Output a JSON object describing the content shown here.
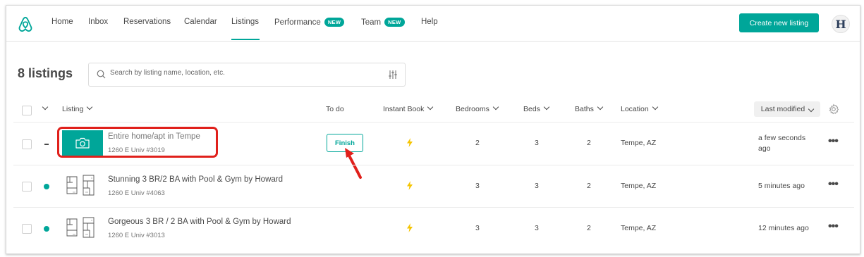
{
  "nav": {
    "items": [
      {
        "label": "Home"
      },
      {
        "label": "Inbox"
      },
      {
        "label": "Reservations"
      },
      {
        "label": "Calendar"
      },
      {
        "label": "Listings"
      },
      {
        "label": "Performance",
        "badge": "NEW"
      },
      {
        "label": "Team",
        "badge": "NEW"
      },
      {
        "label": "Help"
      }
    ],
    "active": "Listings",
    "create_button": "Create new listing",
    "avatar_letter": "H"
  },
  "toolbar": {
    "count": "8 listings",
    "search_placeholder": "Search by listing name, location, etc."
  },
  "table": {
    "headers": {
      "listing": "Listing",
      "todo": "To do",
      "instant_book": "Instant Book",
      "bedrooms": "Bedrooms",
      "beds": "Beds",
      "baths": "Baths",
      "location": "Location",
      "last_modified": "Last modified"
    },
    "rows": [
      {
        "title": "Entire home/apt in Tempe",
        "address": "1260 E Univ #3019",
        "todo": "Finish",
        "bedrooms": "2",
        "beds": "3",
        "baths": "2",
        "location": "Tempe, AZ",
        "modified_line1": "a few seconds",
        "modified_line2": "ago",
        "status": "incomplete"
      },
      {
        "title": "Stunning 3 BR/2 BA with Pool & Gym by Howard",
        "address": "1260 E Univ #4063",
        "todo": "",
        "bedrooms": "3",
        "beds": "3",
        "baths": "2",
        "location": "Tempe, AZ",
        "modified_line1": "5 minutes ago",
        "modified_line2": "",
        "status": "listed"
      },
      {
        "title": "Gorgeous 3 BR / 2 BA with Pool & Gym by Howard",
        "address": "1260 E Univ #3013",
        "todo": "",
        "bedrooms": "3",
        "beds": "3",
        "baths": "2",
        "location": "Tempe, AZ",
        "modified_line1": "12 minutes ago",
        "modified_line2": "",
        "status": "listed"
      }
    ]
  },
  "colors": {
    "accent": "#00a699",
    "annotation": "#e0201b",
    "bolt": "#f5c400"
  },
  "icons": [
    "airbnb-logo-icon",
    "search-icon",
    "filter-icon",
    "chevron-down-icon",
    "gear-icon",
    "camera-icon",
    "floorplan-icon",
    "lightning-icon",
    "more-icon",
    "annotation-arrow-icon"
  ]
}
